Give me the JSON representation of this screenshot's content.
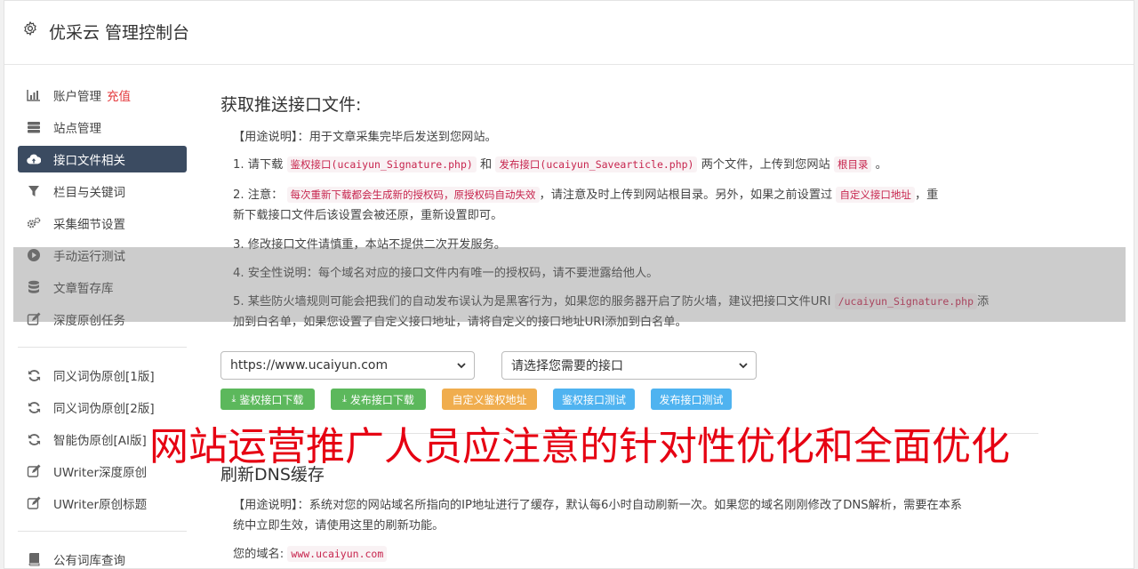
{
  "header": {
    "title": "优采云 管理控制台"
  },
  "sidebar": {
    "items": [
      {
        "label": "账户管理",
        "extra": "充值",
        "icon": "bar-chart-icon"
      },
      {
        "label": "站点管理",
        "icon": "server-icon"
      },
      {
        "label": "接口文件相关",
        "icon": "cloud-upload-icon",
        "active": true
      },
      {
        "label": "栏目与关键词",
        "icon": "filter-icon"
      },
      {
        "label": "采集细节设置",
        "icon": "cogs-icon"
      },
      {
        "label": "手动运行测试",
        "icon": "play-circle-icon"
      },
      {
        "label": "文章暂存库",
        "icon": "database-icon"
      },
      {
        "label": "深度原创任务",
        "icon": "edit-icon"
      }
    ],
    "items2": [
      {
        "label": "同义词伪原创[1版]",
        "icon": "refresh-icon"
      },
      {
        "label": "同义词伪原创[2版]",
        "icon": "refresh-icon"
      },
      {
        "label": "智能伪原创[AI版]",
        "icon": "refresh-icon"
      },
      {
        "label": "UWriter深度原创",
        "icon": "edit-icon"
      },
      {
        "label": "UWriter原创标题",
        "icon": "edit-icon"
      }
    ],
    "items3": [
      {
        "label": "公有词库查询",
        "icon": "book-icon"
      }
    ]
  },
  "section1": {
    "title": "获取推送接口文件:",
    "usage": "【用途说明】：用于文章采集完毕后发送到您网站。",
    "p1": {
      "a": "1. 请下载",
      "code1": "鉴权接口(ucaiyun_Signature.php)",
      "b": "和",
      "code2": "发布接口(ucaiyun_Savearticle.php)",
      "c": "两个文件，上传到您网站",
      "code3": "根目录",
      "d": "。"
    },
    "p2": {
      "a": "2. 注意：",
      "code1": "每次重新下载都会生成新的授权码，原授权码自动失效",
      "b": "，请注意及时上传到网站根目录。另外，如果之前设置过",
      "code2": "自定义接口地址",
      "c": "，重",
      "d": "新下载接口文件后该设置会被还原，重新设置即可。"
    },
    "p3": "3. 修改接口文件请慎重，本站不提供二次开发服务。",
    "p4": "4. 安全性说明：每个域名对应的接口文件内有唯一的授权码，请不要泄露给他人。",
    "p5": {
      "a": "5. 某些防火墙规则可能会把我们的自动发布误认为是黑客行为，如果您的服务器开启了防火墙，建议把接口文件URI",
      "code1": "/ucaiyun_Signature.php",
      "b": "添",
      "c": "加到白名单，如果您设置了自定义接口地址，请将自定义的接口地址URI添加到白名单。"
    },
    "site_select": "https://www.ucaiyun.com",
    "api_select": "请选择您需要的接口",
    "buttons": {
      "b1": "鉴权接口下载",
      "b2": "发布接口下载",
      "b3": "自定义鉴权地址",
      "b4": "鉴权接口测试",
      "b5": "发布接口测试"
    }
  },
  "section2": {
    "title": "刷新DNS缓存",
    "usage_a": "【用途说明】：系统对您的网站域名所指向的IP地址进行了缓存，默认每6小时自动刷新一次。如果您的域名刚刚修改了DNS解析，需要在本系",
    "usage_b": "统中立即生效，请使用这里的刷新功能。",
    "domain_label": "您的域名:",
    "domain_value": "www.ucaiyun.com"
  },
  "banner": "网站运营推广人员应注意的针对性优化和全面优化",
  "colors": {
    "active_nav": "#3b4b61",
    "green_button": "#5cb85c",
    "orange_button": "#f0ad4e",
    "blue_button": "#4fb3f0",
    "banner_red": "#e60012",
    "code_red": "#c7254e"
  }
}
